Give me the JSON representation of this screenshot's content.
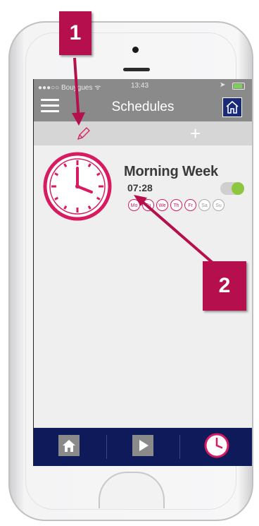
{
  "status_bar": {
    "carrier": "●●●○○ Bouygues ᯤ",
    "time": "13:43"
  },
  "nav": {
    "title": "Schedules"
  },
  "toolbar": {
    "edit_icon": "pencil-icon",
    "add_icon": "plus-icon",
    "add_symbol": "+"
  },
  "schedule": {
    "name": "Morning Week",
    "time": "07:28",
    "enabled": true,
    "days": [
      {
        "label": "Mo",
        "active": true
      },
      {
        "label": "Tu",
        "active": true
      },
      {
        "label": "We",
        "active": true
      },
      {
        "label": "Th",
        "active": true
      },
      {
        "label": "Fr",
        "active": true
      },
      {
        "label": "Sa",
        "active": false
      },
      {
        "label": "Su",
        "active": false
      }
    ]
  },
  "tabs": [
    {
      "icon": "home-icon"
    },
    {
      "icon": "play-icon"
    },
    {
      "icon": "clock-icon"
    }
  ],
  "callouts": [
    {
      "label": "1"
    },
    {
      "label": "2"
    }
  ],
  "colors": {
    "accent": "#d81b60",
    "callout": "#b5104d",
    "nav": "#8a8a8a",
    "tabbar": "#0f1a5a",
    "toggle_on": "#8dc63f"
  }
}
